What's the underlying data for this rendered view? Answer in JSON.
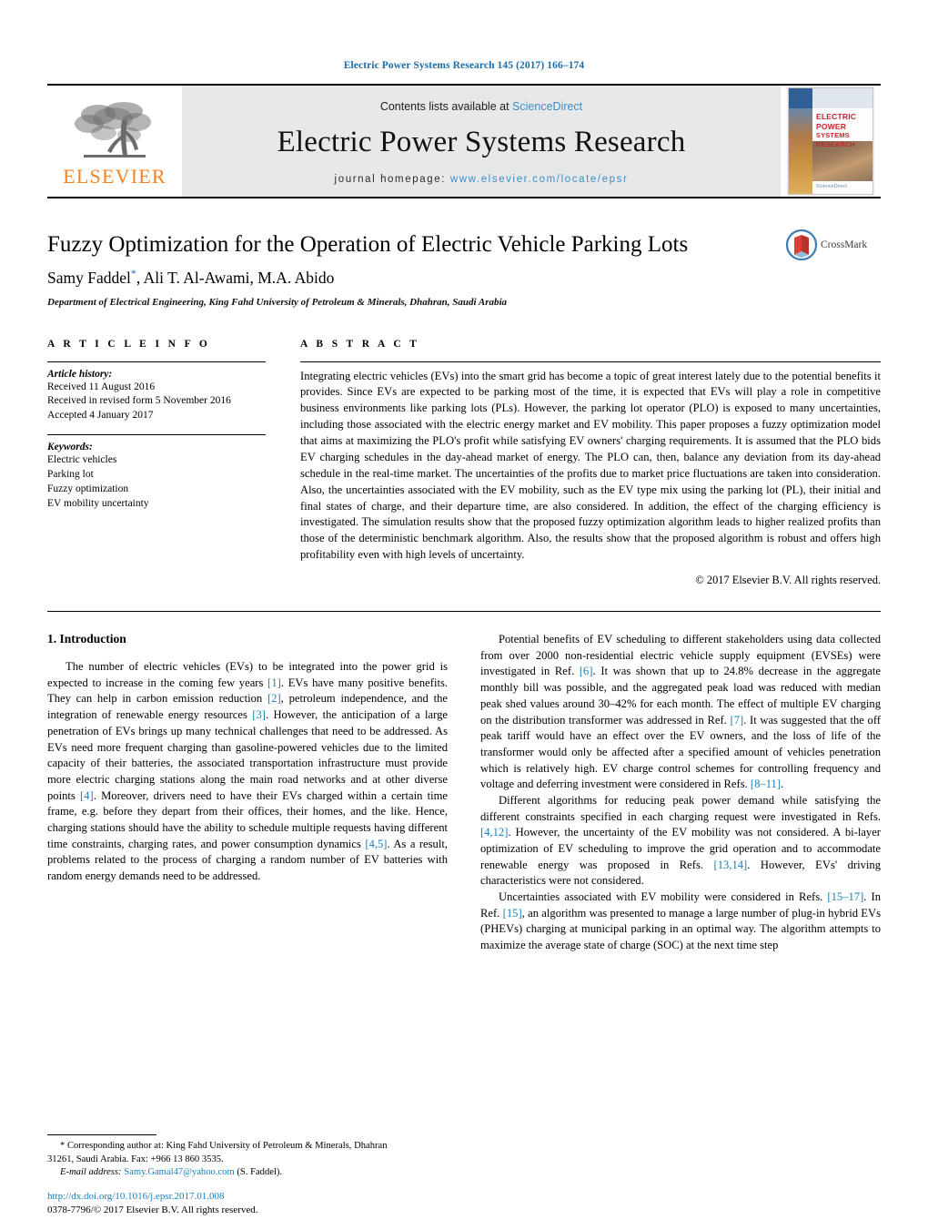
{
  "running_head": "Electric Power Systems Research 145 (2017) 166–174",
  "masthead": {
    "publisher_name": "ELSEVIER",
    "contents_prefix": "Contents lists available at",
    "contents_link": "ScienceDirect",
    "journal_title": "Electric Power Systems Research",
    "homepage_label": "journal homepage:",
    "homepage_url": "www.elsevier.com/locate/epsr",
    "cover": {
      "title_line1": "ELECTRIC POWER",
      "title_line2": "SYSTEMS RESEARCH",
      "footer": "ScienceDirect"
    }
  },
  "article": {
    "title": "Fuzzy Optimization for the Operation of Electric Vehicle Parking Lots",
    "authors_pre": "Samy Faddel",
    "authors_star": "*",
    "authors_post": ", Ali T. Al-Awami, M.A. Abido",
    "affiliation": "Department of Electrical Engineering, King Fahd University of Petroleum & Minerals, Dhahran, Saudi Arabia",
    "crossmark_label": "CrossMark"
  },
  "article_info": {
    "heading": "A R T I C L E   I N F O",
    "history_heading": "Article history:",
    "history": [
      "Received 11 August 2016",
      "Received in revised form 5 November 2016",
      "Accepted 4 January 2017"
    ],
    "keywords_heading": "Keywords:",
    "keywords": [
      "Electric vehicles",
      "Parking lot",
      "Fuzzy optimization",
      "EV mobility uncertainty"
    ]
  },
  "abstract": {
    "heading": "A B S T R A C T",
    "text": "Integrating electric vehicles (EVs) into the smart grid has become a topic of great interest lately due to the potential benefits it provides. Since EVs are expected to be parking most of the time, it is expected that EVs will play a role in competitive business environments like parking lots (PLs). However, the parking lot operator (PLO) is exposed to many uncertainties, including those associated with the electric energy market and EV mobility. This paper proposes a fuzzy optimization model that aims at maximizing the PLO's profit while satisfying EV owners' charging requirements. It is assumed that the PLO bids EV charging schedules in the day-ahead market of energy. The PLO can, then, balance any deviation from its day-ahead schedule in the real-time market. The uncertainties of the profits due to market price fluctuations are taken into consideration. Also, the uncertainties associated with the EV mobility, such as the EV type mix using the parking lot (PL), their initial and final states of charge, and their departure time, are also considered. In addition, the effect of the charging efficiency is investigated. The simulation results show that the proposed fuzzy optimization algorithm leads to higher realized profits than those of the deterministic benchmark algorithm. Also, the results show that the proposed algorithm is robust and offers high profitability even with high levels of uncertainty.",
    "copyright": "© 2017 Elsevier B.V. All rights reserved."
  },
  "body": {
    "section_number_title": "1.  Introduction",
    "left_paragraphs": [
      "The number of electric vehicles (EVs) to be integrated into the power grid is expected to increase in the coming few years [1]. EVs have many positive benefits. They can help in carbon emission reduction [2], petroleum independence, and the integration of renewable energy resources [3]. However, the anticipation of a large penetration of EVs brings up many technical challenges that need to be addressed. As EVs need more frequent charging than gasoline-powered vehicles due to the limited capacity of their batteries, the associated transportation infrastructure must provide more electric charging stations along the main road networks and at other diverse points [4]. Moreover, drivers need to have their EVs charged within a certain time frame, e.g. before they depart from their offices, their homes, and the like. Hence, charging stations should have the ability to schedule multiple requests having different time constraints, charging rates, and power consumption dynamics [4,5]. As a result, problems related to the process of charging a random number of EV batteries with random energy demands need to be addressed."
    ],
    "right_paragraphs": [
      "Potential benefits of EV scheduling to different stakeholders using data collected from over 2000 non-residential electric vehicle supply equipment (EVSEs) were investigated in Ref. [6]. It was shown that up to 24.8% decrease in the aggregate monthly bill was possible, and the aggregated peak load was reduced with median peak shed values around 30–42% for each month. The effect of multiple EV charging on the distribution transformer was addressed in Ref. [7]. It was suggested that the off peak tariff would have an effect over the EV owners, and the loss of life of the transformer would only be affected after a specified amount of vehicles penetration which is relatively high. EV charge control schemes for controlling frequency and voltage and deferring investment were considered in Refs. [8–11].",
      "Different algorithms for reducing peak power demand while satisfying the different constraints specified in each charging request were investigated in Refs. [4,12]. However, the uncertainty of the EV mobility was not considered. A bi-layer optimization of EV scheduling to improve the grid operation and to accommodate renewable energy was proposed in Refs. [13,14]. However, EVs' driving characteristics were not considered.",
      "Uncertainties associated with EV mobility were considered in Refs. [15–17]. In Ref. [15], an algorithm was presented to manage a large number of plug-in hybrid EVs (PHEVs) charging at municipal parking in an optimal way. The algorithm attempts to maximize the average state of charge (SOC) at the next time step"
    ]
  },
  "footnote": {
    "line1": "* Corresponding author at: King Fahd University of Petroleum & Minerals, Dhahran",
    "line2": "31261, Saudi Arabia. Fax: +966 13 860 3535.",
    "email_label": "E-mail address:",
    "email": "Samy.Gamal47@yahoo.com",
    "email_suffix": "(S. Faddel)."
  },
  "doi_block": {
    "doi": "http://dx.doi.org/10.1016/j.epsr.2017.01.008",
    "issn_line": "0378-7796/© 2017 Elsevier B.V. All rights reserved."
  },
  "colors": {
    "link_blue": "#1a7fb5",
    "header_blue": "#1a6ca8",
    "elsevier_orange": "#f58220",
    "masthead_gray": "#e7e8ea",
    "cover_red": "#c8252b"
  }
}
